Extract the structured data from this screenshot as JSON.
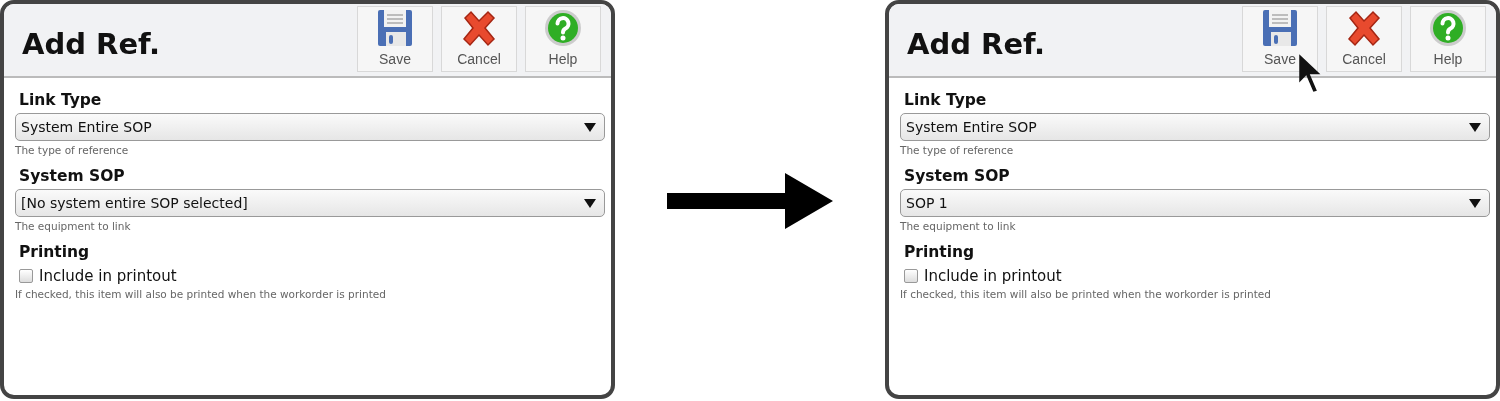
{
  "panels": [
    {
      "title": "Add Ref.",
      "buttons": [
        {
          "kind": "save",
          "label": "Save",
          "pointer": false
        },
        {
          "kind": "cancel",
          "label": "Cancel",
          "pointer": false
        },
        {
          "kind": "help",
          "label": "Help",
          "pointer": false
        }
      ],
      "fields": [
        {
          "kind": "select",
          "label": "Link Type",
          "value": "System Entire SOP",
          "hint": "The type of reference"
        },
        {
          "kind": "select",
          "label": "System SOP",
          "value": "[No system entire SOP selected]",
          "hint": "The equipment to link"
        },
        {
          "kind": "checkbox",
          "label": "Printing",
          "option": "Include in printout",
          "checked": false,
          "hint": "If checked, this item will also be printed when the workorder is printed"
        }
      ]
    },
    {
      "title": "Add Ref.",
      "buttons": [
        {
          "kind": "save",
          "label": "Save",
          "pointer": true
        },
        {
          "kind": "cancel",
          "label": "Cancel",
          "pointer": false
        },
        {
          "kind": "help",
          "label": "Help",
          "pointer": false
        }
      ],
      "fields": [
        {
          "kind": "select",
          "label": "Link Type",
          "value": "System Entire SOP",
          "hint": "The type of reference"
        },
        {
          "kind": "select",
          "label": "System SOP",
          "value": "SOP 1",
          "hint": "The equipment to link"
        },
        {
          "kind": "checkbox",
          "label": "Printing",
          "option": "Include in printout",
          "checked": false,
          "hint": "If checked, this item will also be printed when the workorder is printed"
        }
      ]
    }
  ]
}
